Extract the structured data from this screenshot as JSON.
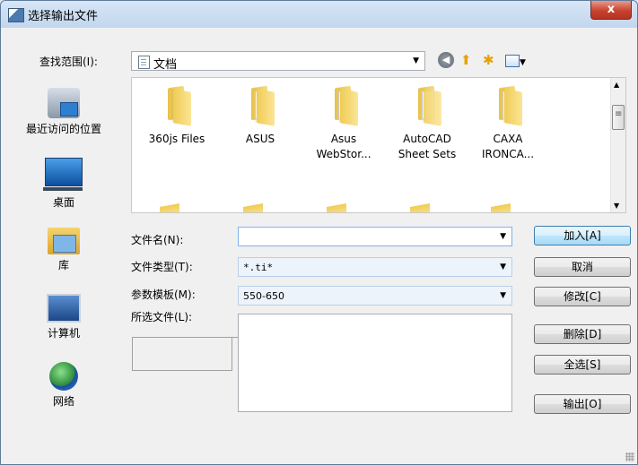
{
  "window": {
    "title": "选择输出文件",
    "close_label": "x"
  },
  "lookin": {
    "label": "查找范围(I):",
    "value": "文档"
  },
  "places": [
    {
      "label": "最近访问的位置",
      "icon": "recent-places-icon"
    },
    {
      "label": "桌面",
      "icon": "desktop-icon"
    },
    {
      "label": "库",
      "icon": "libraries-icon"
    },
    {
      "label": "计算机",
      "icon": "computer-icon"
    },
    {
      "label": "网络",
      "icon": "network-icon"
    }
  ],
  "files": [
    {
      "name1": "360js Files",
      "name2": ""
    },
    {
      "name1": "ASUS",
      "name2": ""
    },
    {
      "name1": "Asus",
      "name2": "WebStor..."
    },
    {
      "name1": "AutoCAD",
      "name2": "Sheet Sets"
    },
    {
      "name1": "CAXA",
      "name2": "IRONCA..."
    }
  ],
  "form": {
    "filename_label": "文件名(N):",
    "filename_value": "",
    "filetype_label": "文件类型(T):",
    "filetype_value": "*.ti*",
    "template_label": "参数模板(M):",
    "template_value": "550-650",
    "selected_label": "所选文件(L):"
  },
  "buttons": {
    "add": "加入[A]",
    "cancel": "取消",
    "modify": "修改[C]",
    "delete": "删除[D]",
    "select_all": "全选[S]",
    "output": "输出[O]"
  }
}
